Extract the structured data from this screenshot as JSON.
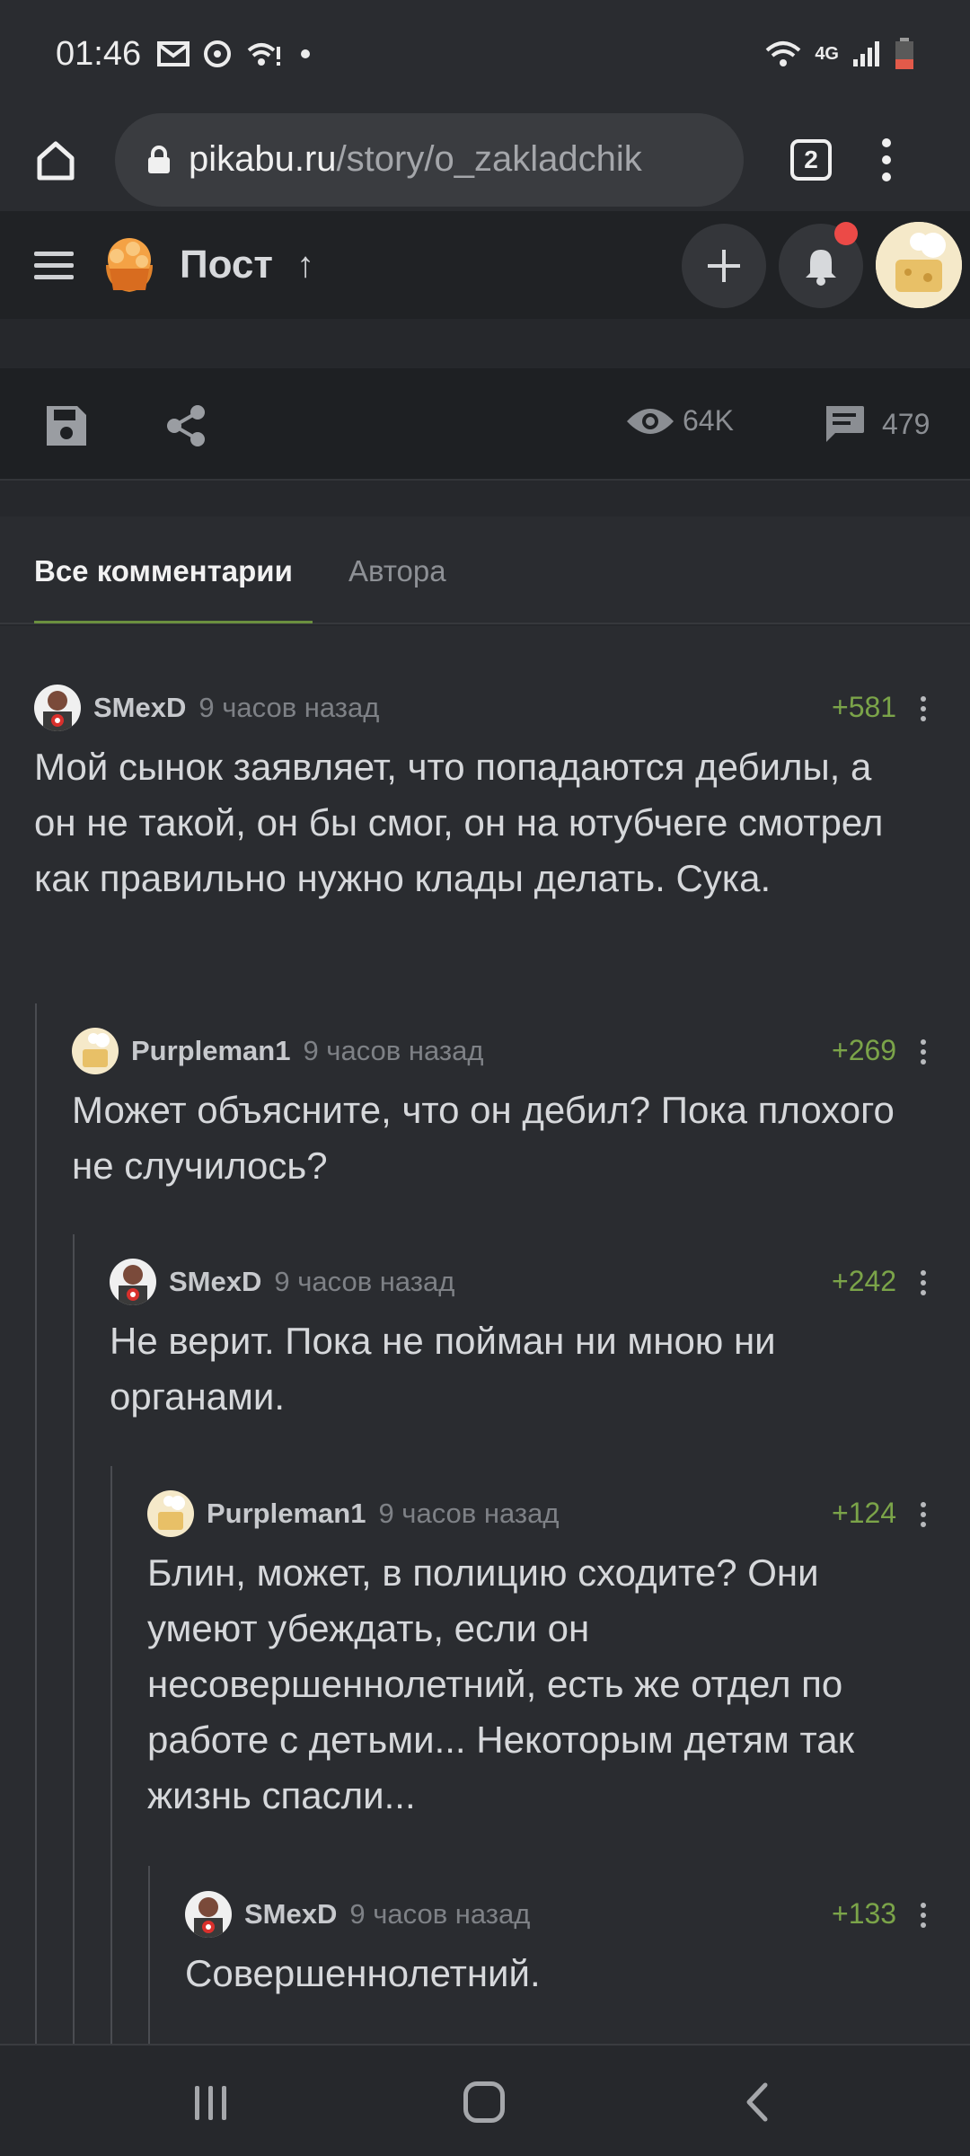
{
  "status_bar": {
    "time": "01:46",
    "network": "4G"
  },
  "browser": {
    "url_domain": "pikabu.ru",
    "url_path": "/story/o_zakladchik",
    "tab_count": "2"
  },
  "site_header": {
    "title": "Пост",
    "up_arrow": "↑"
  },
  "post_actions": {
    "views": "64K",
    "comments": "479"
  },
  "comment_tabs": {
    "all": "Все комментарии",
    "author": "Автора"
  },
  "comments": [
    {
      "author": "SMexD",
      "time": "9 часов назад",
      "rating": "+581",
      "text": "Мой сынок заявляет, что попадаются дебилы, а он не такой, он бы смог, он на ютубчеге смотрел как правильно нужно клады делать. Сука."
    },
    {
      "author": "Purpleman1",
      "time": "9 часов назад",
      "rating": "+269",
      "text": "Может объясните, что он дебил? Пока плохого не случилось?"
    },
    {
      "author": "SMexD",
      "time": "9 часов назад",
      "rating": "+242",
      "text": "Не верит. Пока не пойман ни мною ни органами."
    },
    {
      "author": "Purpleman1",
      "time": "9 часов назад",
      "rating": "+124",
      "text": "Блин, может, в полицию сходите? Они умеют убеждать, если он несовершеннолетний, есть же отдел по работе с детьми... Некоторым детям так жизнь спасли..."
    },
    {
      "author": "SMexD",
      "time": "9 часов назад",
      "rating": "+133",
      "text": "Совершеннолетний."
    }
  ],
  "colors": {
    "rating": "#7ba449",
    "tab_underline": "#6b8f3f",
    "notification_badge": "#ec4a47"
  }
}
